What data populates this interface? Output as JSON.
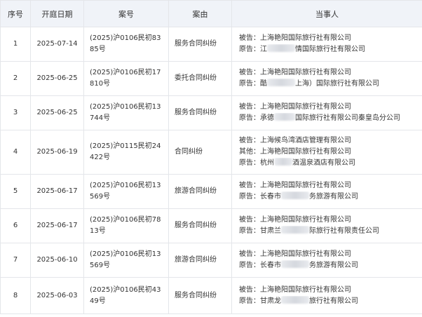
{
  "table": {
    "headers": {
      "seq": "序号",
      "date": "开庭日期",
      "case_no": "案号",
      "cause": "案由",
      "parties": "当事人"
    },
    "rows": [
      {
        "seq": "1",
        "date": "2025-07-14",
        "case_no": "(2025)沪0106民初8385号",
        "cause": "服务合同纠纷",
        "parties": [
          {
            "a": "被告：上海艳阳国际旅行社有限公司",
            "b": ""
          },
          {
            "a": "原告：江",
            "b": "情国际旅行社有限公司"
          }
        ]
      },
      {
        "seq": "2",
        "date": "2025-06-25",
        "case_no": "(2025)沪0106民初17810号",
        "cause": "委托合同纠纷",
        "parties": [
          {
            "a": "被告：上海艳阳国际旅行社有限公司",
            "b": ""
          },
          {
            "a": "原告：酷",
            "b": "上海）国际旅行社有限公司"
          }
        ]
      },
      {
        "seq": "3",
        "date": "2025-06-25",
        "case_no": "(2025)沪0106民初13744号",
        "cause": "服务合同纠纷",
        "parties": [
          {
            "a": "被告：上海艳阳国际旅行社有限公司",
            "b": ""
          },
          {
            "a": "原告：承德",
            "b": "国际旅行社有限公司秦皇岛分公司"
          }
        ]
      },
      {
        "seq": "4",
        "date": "2025-06-19",
        "case_no": "(2025)沪0115民初24422号",
        "cause": "合同纠纷",
        "parties": [
          {
            "a": "被告：上海候鸟湾酒店管理有限公司",
            "b": ""
          },
          {
            "a": "其他：上海艳阳国际旅行社有限公司",
            "b": ""
          },
          {
            "a": "原告：杭州",
            "b": "酒温泉酒店有限公司"
          }
        ]
      },
      {
        "seq": "5",
        "date": "2025-06-17",
        "case_no": "(2025)沪0106民初13569号",
        "cause": "旅游合同纠纷",
        "parties": [
          {
            "a": "被告：上海艳阳国际旅行社有限公司",
            "b": ""
          },
          {
            "a": "原告：长春市",
            "b": "务旅游有限公司"
          }
        ]
      },
      {
        "seq": "6",
        "date": "2025-06-17",
        "case_no": "(2025)沪0106民初7813号",
        "cause": "服务合同纠纷",
        "parties": [
          {
            "a": "被告：上海艳阳国际旅行社有限公司",
            "b": ""
          },
          {
            "a": "原告：甘肃兰",
            "b": "际旅行社有限责任公司"
          }
        ]
      },
      {
        "seq": "7",
        "date": "2025-06-10",
        "case_no": "(2025)沪0106民初13569号",
        "cause": "旅游合同纠纷",
        "parties": [
          {
            "a": "被告：上海艳阳国际旅行社有限公司",
            "b": ""
          },
          {
            "a": "原告：长春市",
            "b": "务旅游有限公司"
          }
        ]
      },
      {
        "seq": "8",
        "date": "2025-06-03",
        "case_no": "(2025)沪0106民初4349号",
        "cause": "服务合同纠纷",
        "parties": [
          {
            "a": "被告：上海艳阳国际旅行社有限公司",
            "b": ""
          },
          {
            "a": "原告：甘肃龙",
            "b": "旅行社有限公司"
          }
        ]
      }
    ]
  }
}
